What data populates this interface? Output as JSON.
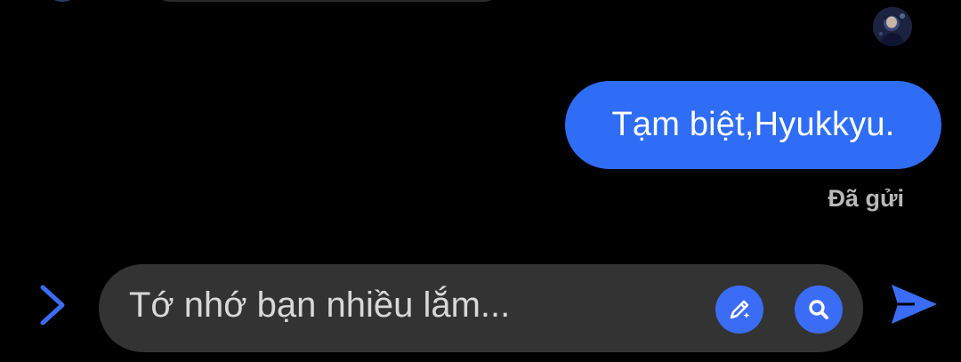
{
  "conversation": {
    "outgoing_message": "Tạm biệt,Hyukkyu.",
    "status": "Đã gửi"
  },
  "composer": {
    "draft_text": "Tớ nhớ bạn nhiều lắm..."
  },
  "icons": {
    "expand": "chevron-right-icon",
    "pen": "magic-pen-icon",
    "search": "search-icon",
    "send": "send-icon"
  },
  "colors": {
    "accent": "#2f6df6",
    "background": "#000000",
    "input_bg": "#333333",
    "status_text": "#b9b9b9"
  }
}
